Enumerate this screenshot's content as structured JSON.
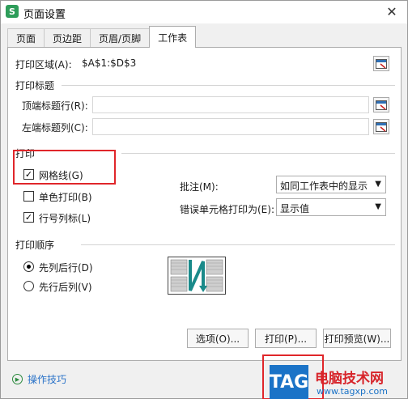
{
  "window": {
    "title": "页面设置",
    "app_icon_letter": "S",
    "close_symbol": "✕"
  },
  "tabs": [
    {
      "label": "页面",
      "active": false
    },
    {
      "label": "页边距",
      "active": false
    },
    {
      "label": "页眉/页脚",
      "active": false
    },
    {
      "label": "工作表",
      "active": true
    }
  ],
  "print_area": {
    "label": "打印区域(A):",
    "value": "$A$1:$D$3"
  },
  "print_titles": {
    "group_label": "打印标题",
    "top_rows_label": "顶端标题行(R):",
    "top_rows_value": "",
    "left_cols_label": "左端标题列(C):",
    "left_cols_value": ""
  },
  "print": {
    "group_label": "打印",
    "gridlines": {
      "label": "网格线(G)",
      "checked": true,
      "mark": "☑"
    },
    "mono": {
      "label": "单色打印(B)",
      "checked": false
    },
    "row_col_headings": {
      "label": "行号列标(L)",
      "checked": true,
      "mark": "☑"
    },
    "comments": {
      "label": "批注(M):",
      "value": "如同工作表中的显示"
    },
    "errors": {
      "label": "错误单元格打印为(E):",
      "value": "显示值"
    }
  },
  "page_order": {
    "group_label": "打印顺序",
    "down_then_over": {
      "label": "先列后行(D)",
      "selected": true
    },
    "over_then_down": {
      "label": "先行后列(V)",
      "selected": false
    }
  },
  "buttons": {
    "options": "选项(O)...",
    "print": "打印(P)...",
    "print_preview": "打印预览(W)..."
  },
  "help": {
    "label": "操作技巧"
  },
  "watermark": {
    "tag": "TAG",
    "line1": "电脑技术网",
    "line2": "www.tagxp.com"
  },
  "colors": {
    "highlight_red": "#e0262a",
    "link_blue": "#2b73c8",
    "tag_blue": "#1b73c7"
  }
}
